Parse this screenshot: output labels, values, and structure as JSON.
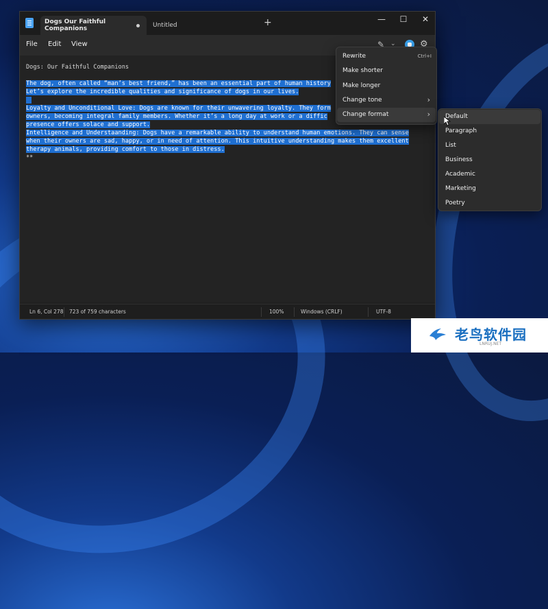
{
  "tabs": [
    {
      "label": "Dogs Our Faithful Companions"
    },
    {
      "label": "Untitled"
    }
  ],
  "new_tab_glyph": "+",
  "window_controls": {
    "minimize": "—",
    "maximize": "☐",
    "close": "✕"
  },
  "menubar": {
    "file": "File",
    "edit": "Edit",
    "view": "View"
  },
  "editor": {
    "lines": [
      "Dogs: Our Faithful Companions",
      "",
      "The dog, often called “man’s best friend,” has been an essential part of human history",
      "Let’s explore the incredible qualities and significance of dogs in our lives.",
      "",
      "Loyalty and Unconditional Love: Dogs are known for their unwavering loyalty. They form",
      "owners, becoming integral family members. Whether it’s a long day at work or a diffic",
      "presence offers solace and support.",
      "Intelligence and Understaanding: Dogs have a remarkable ability to understand human emotions. They can sense",
      "when their owners are sad, happy, or in need of attention. This intuitive understanding makes them excellent",
      "therapy animals, providing comfort to those in distress.",
      "**"
    ]
  },
  "status": {
    "position": "Ln 6, Col 278",
    "chars": "723 of 759 characters",
    "zoom": "100%",
    "line_ending": "Windows (CRLF)",
    "encoding": "UTF-8"
  },
  "context_menu": {
    "items": [
      {
        "label": "Rewrite",
        "shortcut": "Ctrl+I"
      },
      {
        "label": "Make shorter",
        "shortcut": ""
      },
      {
        "label": "Make longer",
        "shortcut": ""
      },
      {
        "label": "Change tone",
        "shortcut": ""
      },
      {
        "label": "Change format",
        "shortcut": ""
      }
    ]
  },
  "format_submenu": {
    "items": [
      {
        "label": "Default"
      },
      {
        "label": "Paragraph"
      },
      {
        "label": "List"
      },
      {
        "label": "Business"
      },
      {
        "label": "Academic"
      },
      {
        "label": "Marketing"
      },
      {
        "label": "Poetry"
      }
    ]
  },
  "watermark": {
    "text": "老鸟软件园",
    "sub": "LNRUJ.NET"
  },
  "colors": {
    "selection": "#1f6fd1",
    "accent": "#3aa4f0"
  }
}
